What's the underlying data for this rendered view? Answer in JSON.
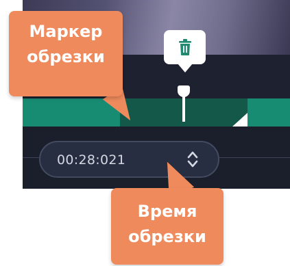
{
  "callouts": {
    "trim_marker": {
      "line1": "Маркер",
      "line2": "обрезки"
    },
    "trim_time": {
      "line1": "Время",
      "line2": "обрезки"
    }
  },
  "time_field": {
    "value": "00:28:021"
  },
  "icons": {
    "delete": "trash-icon",
    "spinner": "up-down-chevron-icon",
    "trim_end": "triangle-corner-handle-icon",
    "playhead": "playhead-marker-icon"
  },
  "colors": {
    "panel_bg": "#1b1f2b",
    "timeline_green": "#188c72",
    "selected_segment": "#14584a",
    "callout_orange": "#ee8a5c",
    "time_field_bg": "#272e41",
    "delete_icon": "#1f8a70"
  }
}
